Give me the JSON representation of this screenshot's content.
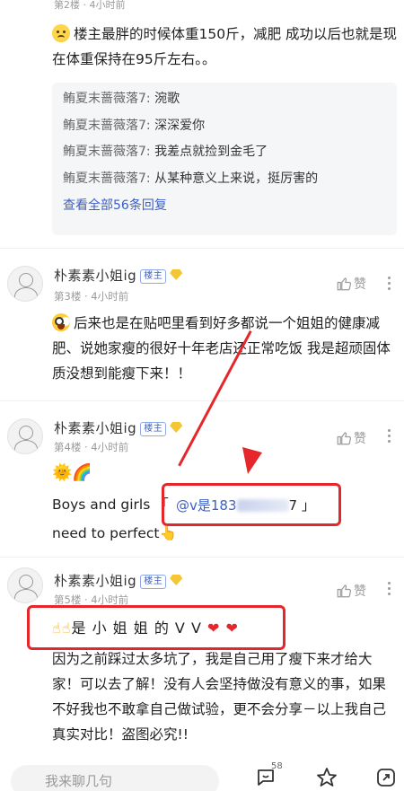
{
  "post1": {
    "meta": "第2楼 · 4小时前",
    "text": "楼主最胖的时候体重150斤，减肥 成功以后也就是现在体重保持在95斤左右。。",
    "replies": [
      {
        "nick": "鲔夏末蔷薇落7:",
        "text": " 涴歌"
      },
      {
        "nick": "鲔夏末蔷薇落7:",
        "text": " 深深爱你"
      },
      {
        "nick": "鲔夏末蔷薇落7:",
        "text": " 我差点就捡到金毛了"
      },
      {
        "nick": "鲔夏末蔷薇落7:",
        "text": " 从某种意义上来说，挺厉害的"
      }
    ],
    "view_all": "查看全部56条回复"
  },
  "post2": {
    "name": "朴素素小姐ig",
    "badge": "楼主",
    "meta": "第3楼 · 4小时前",
    "like": "赞",
    "text": "后来也是在贴吧里看到好多都说一个姐姐的健康减肥、说她家瘦的很好十年老店还正常吃饭 我是超顽固体质没想到能瘦下来！！"
  },
  "post3": {
    "name": "朴素素小姐ig",
    "badge": "楼主",
    "meta": "第4楼 · 4小时前",
    "like": "赞",
    "icons": "🌞🌈",
    "line1": "Boys and girls 「",
    "mention": "@v是183",
    "mention_end": "7 」",
    "line2": "need to perfect",
    "line2_emoji": "👆"
  },
  "post4": {
    "name": "朴素素小姐ig",
    "badge": "楼主",
    "meta": "第5楼 · 4小时前",
    "like": "赞",
    "highlight_prefix": "☝☝",
    "highlight": "是 小 姐 姐 的 V V",
    "highlight_hearts": "❤ ❤",
    "text": "因为之前踩过太多坑了，我是自己用了瘦下来才给大家！可以去了解！没有人会坚持做没有意义的事，如果不好我也不敢拿自己做试验，更不会分享－以上我自己真实对比！盗图必究!!"
  },
  "footer": {
    "input_placeholder": "我来聊几句",
    "comment_count": "58"
  },
  "colors": {
    "accent_blue": "#3b5fc6",
    "annotation_red": "#e5262b"
  }
}
